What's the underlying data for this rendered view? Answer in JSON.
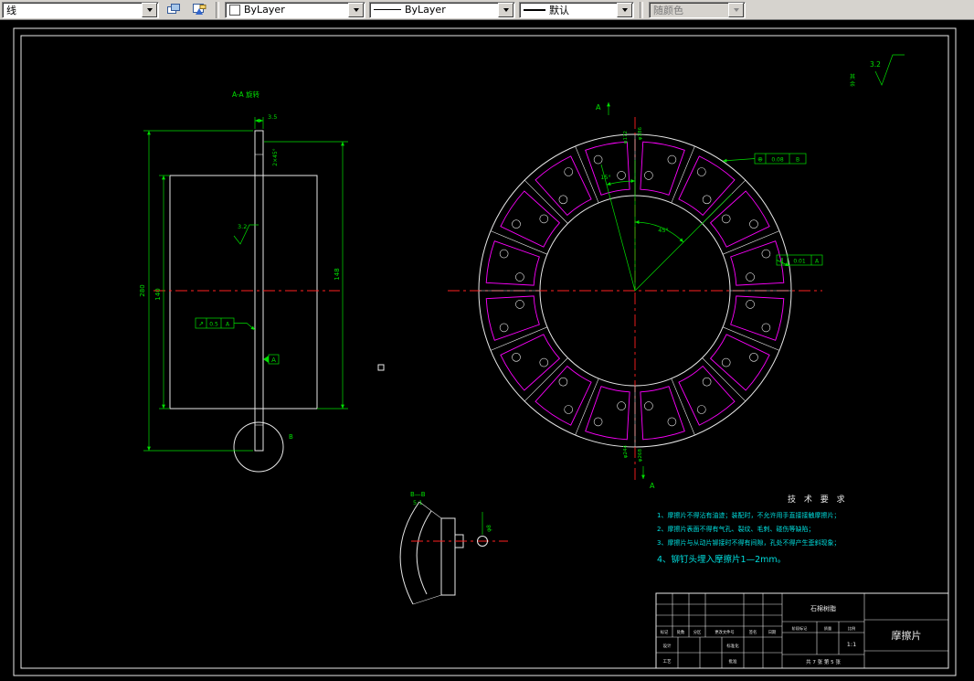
{
  "toolbar": {
    "layer_value": "线",
    "color_value": "ByLayer",
    "linetype_value": "ByLayer",
    "lineweight_value": "默认",
    "plotstyle_value": "随颜色"
  },
  "views": {
    "left": {
      "title": "A-A 旋转",
      "dim_thickness": "3.5",
      "chamfer": "2×45°",
      "roughness": "3.2",
      "dim_outer": "280",
      "dim_inner": "140",
      "dim_right": "148",
      "tol_symbol": "↗",
      "tol_value": "0.5",
      "tol_datum": "A",
      "datum": "A",
      "detail_mark": "B"
    },
    "ring": {
      "section_mark_top": "A",
      "section_mark_bottom": "A",
      "angle_small": "15°",
      "angle_large": "45°",
      "tol1_symbol": "⊕",
      "tol1_value": "0.08",
      "tol1_datum": "B",
      "tol2_symbol": "∥",
      "tol2_value": "0.01",
      "tol2_datum": "A",
      "dia_top_1": "φ172",
      "dia_top_2": "φ186",
      "dia_bottom_1": "φ244",
      "dia_bottom_2": "φ268"
    },
    "detail": {
      "label": "B—B",
      "scale": "5:1",
      "hole": "φ8"
    },
    "corner": {
      "roughness": "3.2",
      "note_1": "其",
      "note_2": "余"
    }
  },
  "tech": {
    "title": "技 术 要 求",
    "items": [
      "1、摩擦片不得沾有油迹；装配时，不允许用手直接接触摩擦片；",
      "2、摩擦片表面不得有气孔、裂纹、毛刺、碰伤等缺陷；",
      "3、摩擦片与从动片铆接时不得有间隙，孔处不得产生歪斜现象；",
      "4、铆钉头埋入摩擦片1—2mm。"
    ]
  },
  "titleblock": {
    "material": "石棉树脂",
    "part": "摩擦片",
    "scale": "1:1",
    "sheets": "共 7 张 第 5 张",
    "stage": "阶段标记",
    "mass": "质量",
    "ratio": "比例",
    "h1": "标记",
    "h2": "处数",
    "h3": "分区",
    "h4": "更改文件号",
    "h5": "签名",
    "h6": "日期",
    "r1": "设计",
    "r2": "工艺",
    "r3": "标准化",
    "r4": "批准"
  }
}
